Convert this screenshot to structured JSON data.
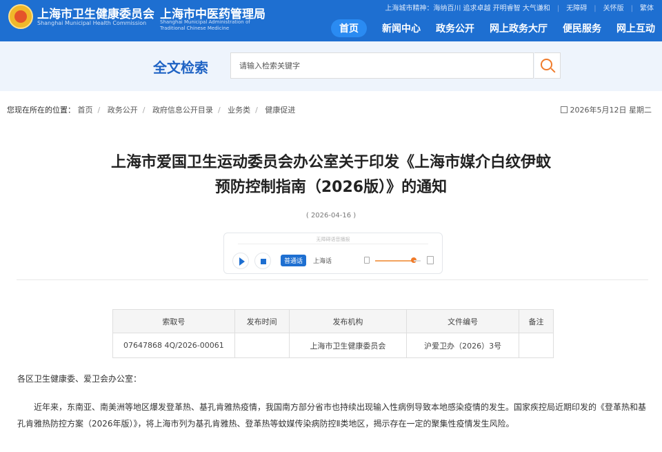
{
  "header": {
    "org1_name": "上海市卫生健康委员会",
    "org1_en": "Shanghai Municipal Health Commission",
    "org2_name": "上海市中医药管理局",
    "org2_en": "Shanghai Municipal Administration of Traditional Chinese Medicine",
    "city_spirit": "上海城市精神：海纳百川 追求卓越 开明睿智 大气谦和",
    "util_links": [
      "无障碍",
      "关怀版",
      "繁体"
    ],
    "nav": [
      "首页",
      "新闻中心",
      "政务公开",
      "网上政务大厅",
      "便民服务",
      "网上互动"
    ],
    "nav_active": "首页",
    "brand_color": "#1e6fd1"
  },
  "search": {
    "title": "全文检索",
    "placeholder": "请输入检索关键字",
    "icon": "search-icon"
  },
  "breadcrumb": {
    "lead": "您现在所在的位置：",
    "items": [
      "首页",
      "政务公开",
      "政府信息公开目录",
      "业务类",
      "健康促进"
    ]
  },
  "today": "2026年5月12日 星期二",
  "article": {
    "title_line1": "上海市爱国卫生运动委员会办公室关于印发《上海市媒介白纹伊蚊",
    "title_line2": "预防控制指南（2026版）》的通知",
    "date": "( 2026-04-16 )",
    "player": {
      "tip": "无障碍语音播报",
      "lang_active": "普通话",
      "lang_other": "上海话",
      "volume": 0.85
    },
    "meta_headers": [
      "索取号",
      "发布时间",
      "发布机构",
      "文件编号",
      "备注"
    ],
    "meta_values": [
      "07647868 4Q/2026-00061",
      "",
      "上海市卫生健康委员会",
      "沪爱卫办（2026）3号",
      ""
    ],
    "greeting": "各区卫生健康委、爱卫会办公室：",
    "paragraph": "近年来，东南亚、南美洲等地区爆发登革热、基孔肯雅热疫情，我国南方部分省市也持续出现输入性病例导致本地感染疫情的发生。国家疾控局近期印发的《登革热和基孔肯雅热防控方案（2026年版）》，将上海市列为基孔肯雅热、登革热等蚊媒传染病防控Ⅱ类地区，揭示存在一定的聚集性疫情发生风险。"
  }
}
